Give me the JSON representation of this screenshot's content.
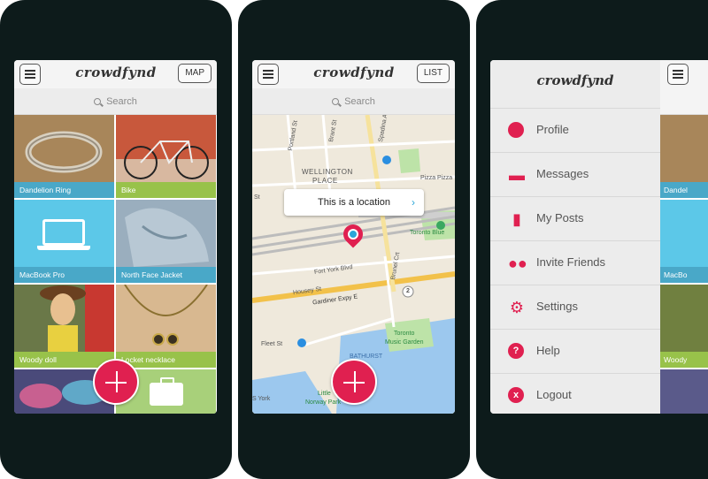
{
  "brand": {
    "name": "crowdfynd",
    "accent": "#e02050",
    "tile_blue": "#49a8c8",
    "tile_green": "#98c24a"
  },
  "screen_grid": {
    "map_button": "MAP",
    "search_placeholder": "Search",
    "tiles": [
      {
        "caption": "Dandelion Ring"
      },
      {
        "caption": "Bike"
      },
      {
        "caption": "MacBook Pro"
      },
      {
        "caption": "North Face Jacket"
      },
      {
        "caption": "Woody doll"
      },
      {
        "caption": "Locket necklace"
      }
    ]
  },
  "screen_map": {
    "list_button": "LIST",
    "search_placeholder": "Search",
    "callout": "This is a location",
    "labels": {
      "wellington_1": "WELLINGTON",
      "wellington_2": "PLACE",
      "pizza": "Pizza Pizza",
      "toronto_blue": "Toronto Blue",
      "fort_york": "Fort York Blvd",
      "housey": "Housey St",
      "gardiner": "Gardiner Expy E",
      "fleet": "Fleet St",
      "bathurst": "BATHURST",
      "music_1": "Toronto",
      "music_2": "Music Garden",
      "little_1": "Little",
      "little_2": "Norway Park",
      "york": "S York",
      "portland": "Portland St",
      "brant": "Brant St",
      "spadina": "Spadina Ave",
      "brunel": "Brunel Crt",
      "st": "St",
      "route": "2"
    }
  },
  "screen_menu": {
    "items": [
      {
        "label": "Profile",
        "icon": "avatar-pin-icon"
      },
      {
        "label": "Messages",
        "icon": "chat-bubbles-icon"
      },
      {
        "label": "My Posts",
        "icon": "clipboard-icon"
      },
      {
        "label": "Invite Friends",
        "icon": "people-icon"
      },
      {
        "label": "Settings",
        "icon": "gear-icon"
      },
      {
        "label": "Help",
        "icon": "question-icon"
      },
      {
        "label": "Logout",
        "icon": "x-icon"
      }
    ],
    "help_glyph": "?",
    "logout_glyph": "x",
    "peek_captions": [
      "Dandel",
      "MacBo",
      "Woody"
    ]
  }
}
